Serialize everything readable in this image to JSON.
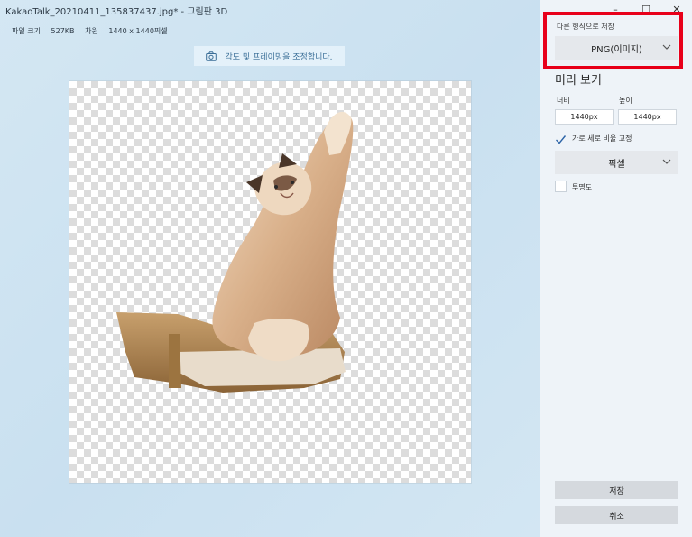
{
  "window": {
    "title": "KakaoTalk_20210411_135837437.jpg* - 그림판 3D",
    "controls": [
      "–",
      "☐",
      "✕"
    ]
  },
  "file_info": {
    "size_label": "파일 크기",
    "size_value": "527KB",
    "dims_label": "차원",
    "dims_value": "1440 x 1440픽셀"
  },
  "hint": {
    "text": "각도 및 프레이밍을 조정합니다.",
    "icon": "camera-icon"
  },
  "panel": {
    "save_as_label": "다른 형식으로 저장",
    "format_value": "PNG(이미지)",
    "preview_title": "미리 보기",
    "width_label": "너비",
    "height_label": "높이",
    "width_value": "1440px",
    "height_value": "1440px",
    "lock_ratio_label": "가로 세로 비율 고정",
    "lock_ratio_checked": true,
    "unit_value": "픽셀",
    "transparency_label": "투명도",
    "transparency_checked": false,
    "save_button": "저장",
    "cancel_button": "취소"
  },
  "colors": {
    "highlight_box": "#e8001a",
    "hint_text": "#3a6e97",
    "panel_bg": "#eef3f8"
  }
}
